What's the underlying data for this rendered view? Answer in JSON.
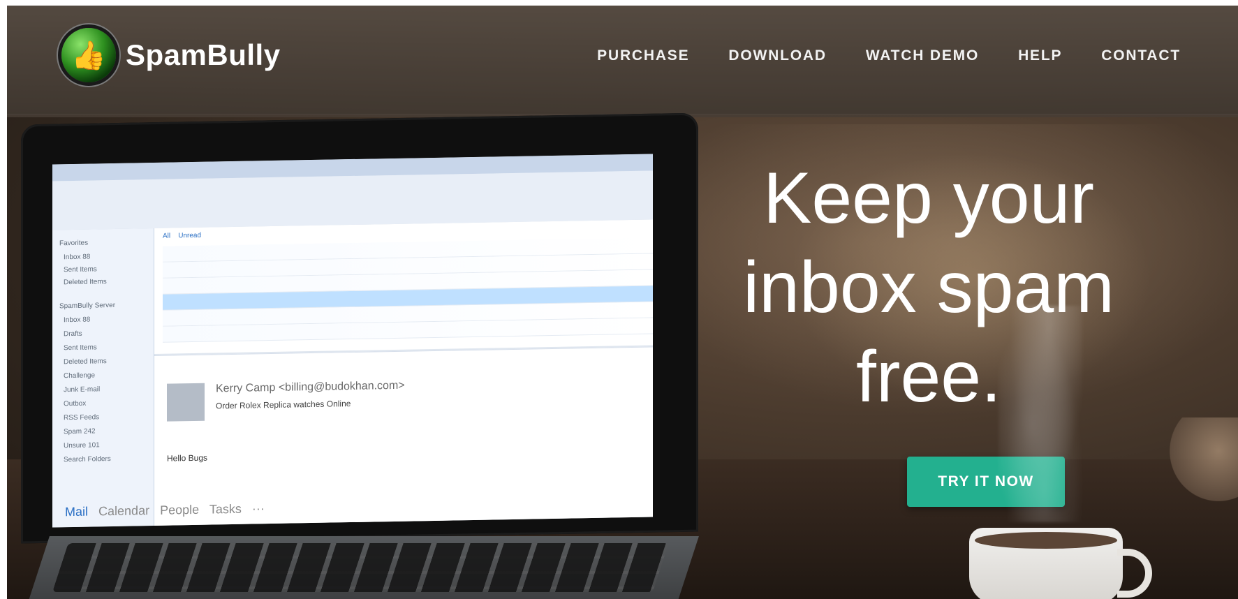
{
  "brand": {
    "name": "SpamBully",
    "logo_icon": "thumbs-up-logo-icon",
    "logo_glyph": "👍"
  },
  "nav": {
    "items": [
      {
        "label": "PURCHASE"
      },
      {
        "label": "DOWNLOAD"
      },
      {
        "label": "WATCH DEMO"
      },
      {
        "label": "HELP"
      },
      {
        "label": "CONTACT"
      }
    ]
  },
  "hero": {
    "title_lines": [
      "Keep your",
      "inbox spam",
      "free."
    ],
    "cta_label": "TRY IT NOW"
  },
  "colors": {
    "cta": "#23b08f",
    "overlay": "#3c342e"
  },
  "screen": {
    "footer_nav": [
      "Mail",
      "Calendar",
      "People",
      "Tasks",
      "···"
    ],
    "selected_sender": "Kerry Camp",
    "selected_sender_email": "<billing@budokhan.com>",
    "selected_subject": "Order Rolex Replica watches Online",
    "greeting": "Hello Bugs",
    "tabs": [
      "All",
      "Unread"
    ]
  }
}
